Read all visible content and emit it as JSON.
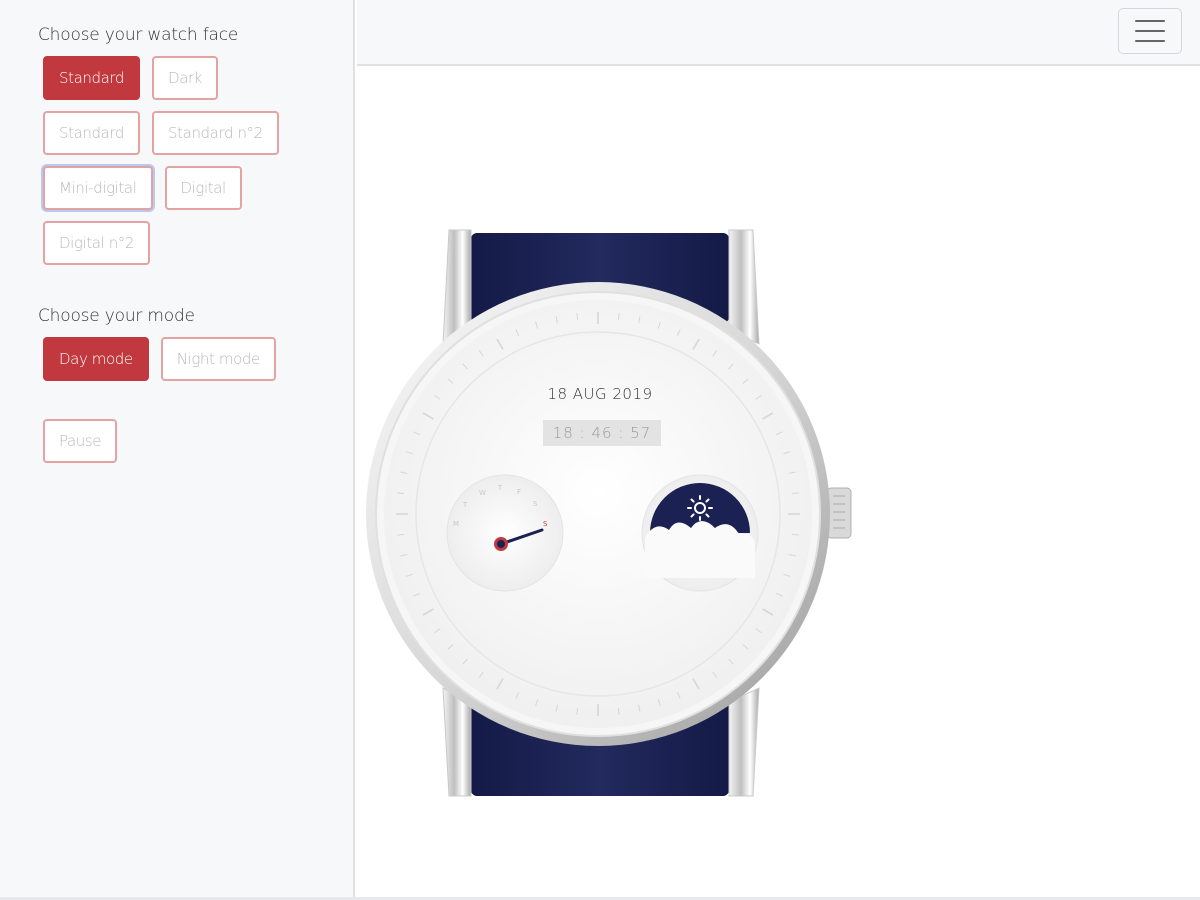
{
  "sidebar": {
    "watch_face_title": "Choose your watch face",
    "watch_faces": [
      {
        "label": "Standard",
        "active": true
      },
      {
        "label": "Dark"
      },
      {
        "label": "Standard"
      },
      {
        "label": "Standard n°2"
      },
      {
        "label": "Mini-digital",
        "focused": true
      },
      {
        "label": "Digital"
      },
      {
        "label": "Digital n°2"
      }
    ],
    "mode_title": "Choose your mode",
    "modes": [
      {
        "label": "Day mode",
        "active": true
      },
      {
        "label": "Night mode"
      }
    ],
    "pause_label": "Pause"
  },
  "topbar": {
    "menu_icon": "hamburger-menu-icon"
  },
  "watch": {
    "date": "18 AUG 2019",
    "time": "18 : 46 : 57",
    "day_dial_labels": [
      "M",
      "T",
      "W",
      "T",
      "F",
      "S",
      "S"
    ],
    "moonphase_icon": "sun-icon",
    "colors": {
      "strap": "#1b2253",
      "accent_red": "#c1393e",
      "moon_disc": "#1b2253"
    }
  }
}
